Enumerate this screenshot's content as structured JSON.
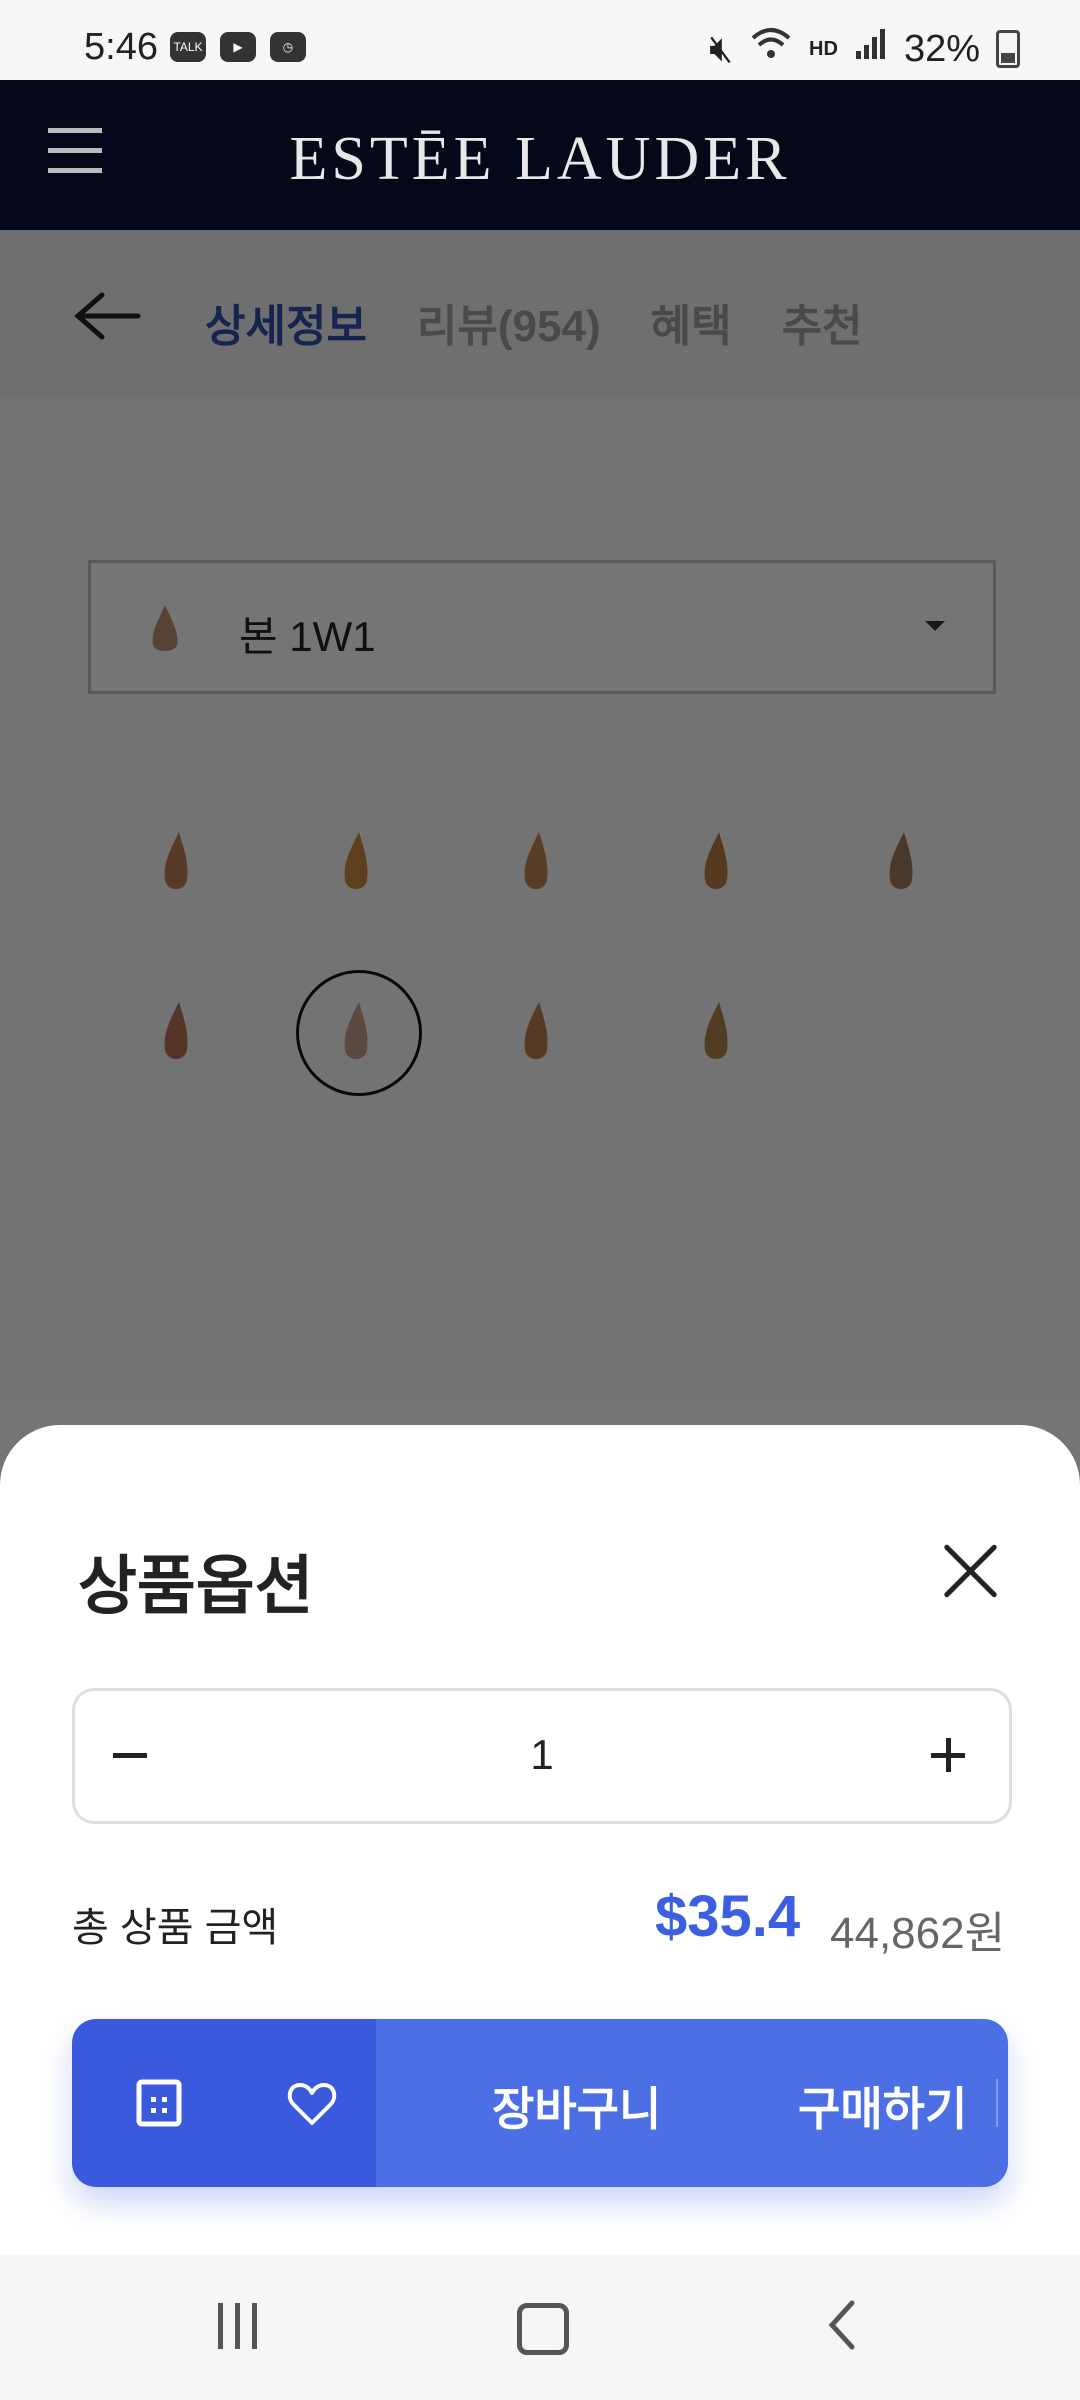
{
  "status_bar": {
    "time": "5:46",
    "left_icons": [
      "talk-icon",
      "youtube-icon",
      "clock-icon"
    ],
    "right_icons": [
      "mute-icon",
      "wifi-icon",
      "hd-voice-icon",
      "signal-icon"
    ],
    "hd_label": "HD",
    "battery": "32%"
  },
  "header": {
    "brand": "ESTĒE LAUDER"
  },
  "tabs": {
    "items": [
      {
        "label": "상세정보",
        "active": true
      },
      {
        "label": "리뷰(954)",
        "active": false
      },
      {
        "label": "혜택",
        "active": false
      },
      {
        "label": "추천",
        "active": false
      }
    ]
  },
  "shade_select": {
    "selected": "본 1W1",
    "swatch_color": "#b98a70"
  },
  "swatch_colors": [
    "#b77a52",
    "#c48640",
    "#b98252",
    "#b47a44",
    "#9c7658",
    "#b06f55",
    "#c09a86",
    "#b37a4c",
    "#a97f48"
  ],
  "sheet": {
    "title": "상품옵션",
    "quantity": "1",
    "total_label": "총 상품 금액",
    "price_usd": "$35.4",
    "price_krw": "44,862원",
    "cart_label": "장바구니",
    "buy_label": "구매하기"
  },
  "colors": {
    "accent_blue": "#3b5fe0",
    "header_bg": "#050819"
  }
}
